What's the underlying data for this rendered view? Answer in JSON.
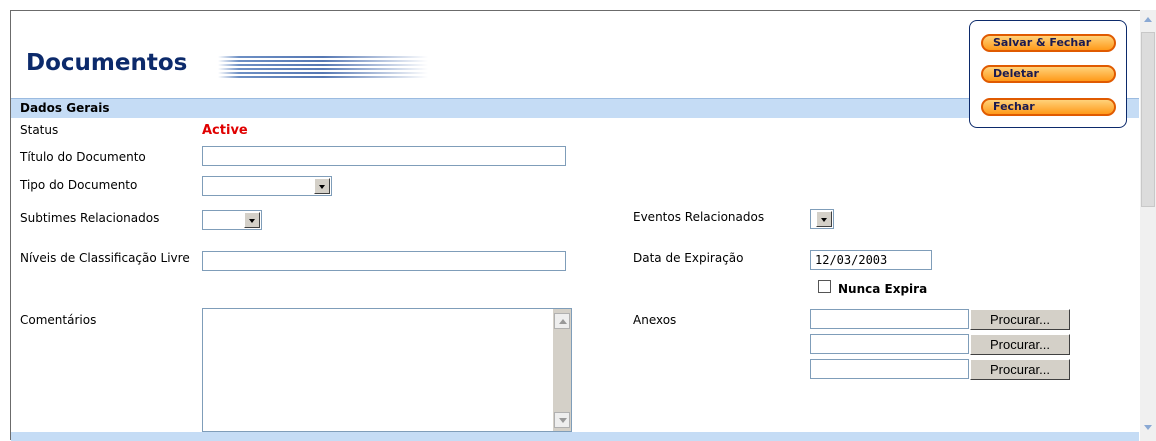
{
  "header": {
    "title": "Documentos"
  },
  "actions": {
    "save_close": "Salvar & Fechar",
    "delete": "Deletar",
    "close": "Fechar"
  },
  "section": {
    "label": "Dados Gerais"
  },
  "form": {
    "status_label": "Status",
    "status_value": "Active",
    "titulo_label": "Título do Documento",
    "titulo_value": "",
    "tipo_label": "Tipo do Documento",
    "subtimes_label": "Subtimes Relacionados",
    "niveis_label": "Níveis de Classificação Livre",
    "niveis_value": "",
    "comentarios_label": "Comentários",
    "eventos_label": "Eventos Relacionados",
    "expiracao_label": "Data de Expiração",
    "expiracao_value": "12/03/2003",
    "nunca_expira_label": "Nunca Expira",
    "nunca_expira_checked": false,
    "anexos_label": "Anexos",
    "browse_label": "Procurar..."
  },
  "colors": {
    "title": "#0c2a6b",
    "status": "#e00000",
    "section_bar": "#c5dcf5",
    "button_orange": "#ff9a1a"
  }
}
